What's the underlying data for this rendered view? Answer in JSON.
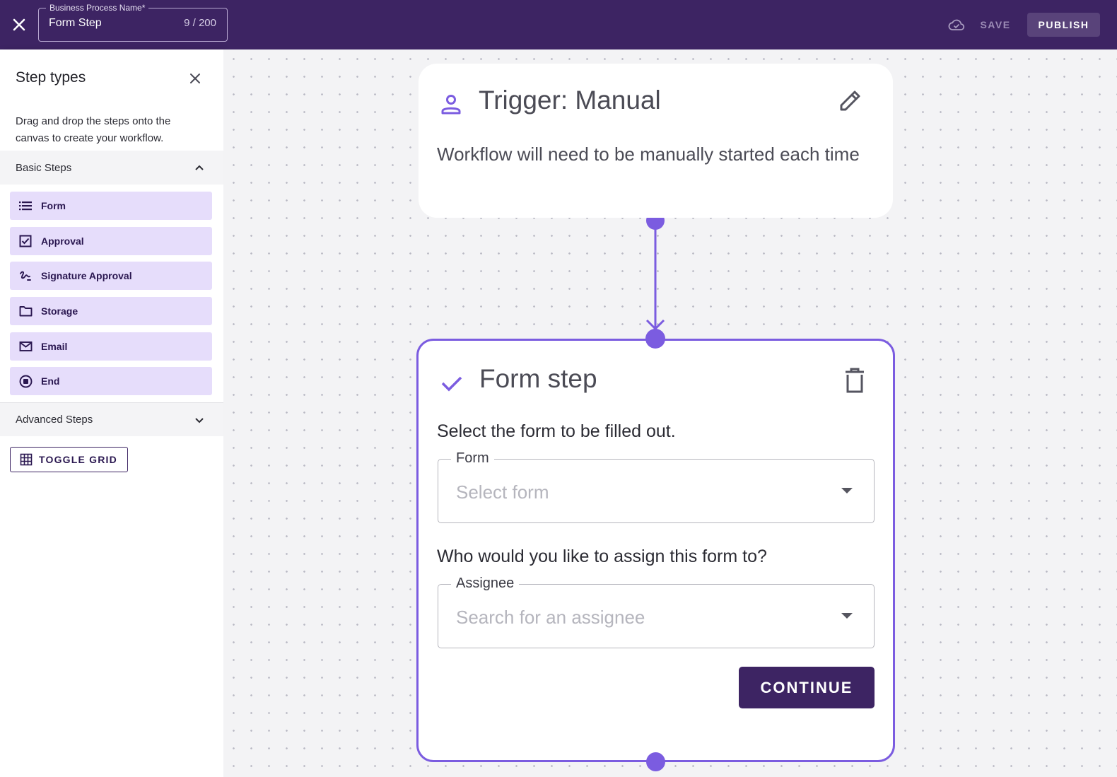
{
  "header": {
    "process_name_label": "Business Process Name*",
    "process_name_value": "Form Step",
    "char_count": "9 / 200",
    "save_label": "SAVE",
    "publish_label": "PUBLISH"
  },
  "sidebar": {
    "title": "Step types",
    "description": "Drag and drop the steps onto the canvas to create your workflow.",
    "basic_section": "Basic Steps",
    "advanced_section": "Advanced Steps",
    "items": [
      {
        "label": "Form",
        "icon": "list-icon"
      },
      {
        "label": "Approval",
        "icon": "checkbox-icon"
      },
      {
        "label": "Signature Approval",
        "icon": "signature-icon"
      },
      {
        "label": "Storage",
        "icon": "folder-icon"
      },
      {
        "label": "Email",
        "icon": "mail-icon"
      },
      {
        "label": "End",
        "icon": "stop-circle-icon"
      }
    ],
    "toggle_grid_label": "TOGGLE GRID"
  },
  "canvas": {
    "trigger": {
      "title": "Trigger: Manual",
      "description": "Workflow will need to be manually started each time"
    },
    "form_step": {
      "title": "Form step",
      "question1": "Select the form to be filled out.",
      "form_label": "Form",
      "form_placeholder": "Select form",
      "question2": "Who would you like to assign this form to?",
      "assignee_label": "Assignee",
      "assignee_placeholder": "Search for an assignee",
      "continue_label": "CONTINUE"
    }
  },
  "colors": {
    "header_bg": "#3d2463",
    "accent": "#7b5ce0",
    "step_item_bg": "#e6ddfb",
    "primary_button": "#3d2463"
  }
}
